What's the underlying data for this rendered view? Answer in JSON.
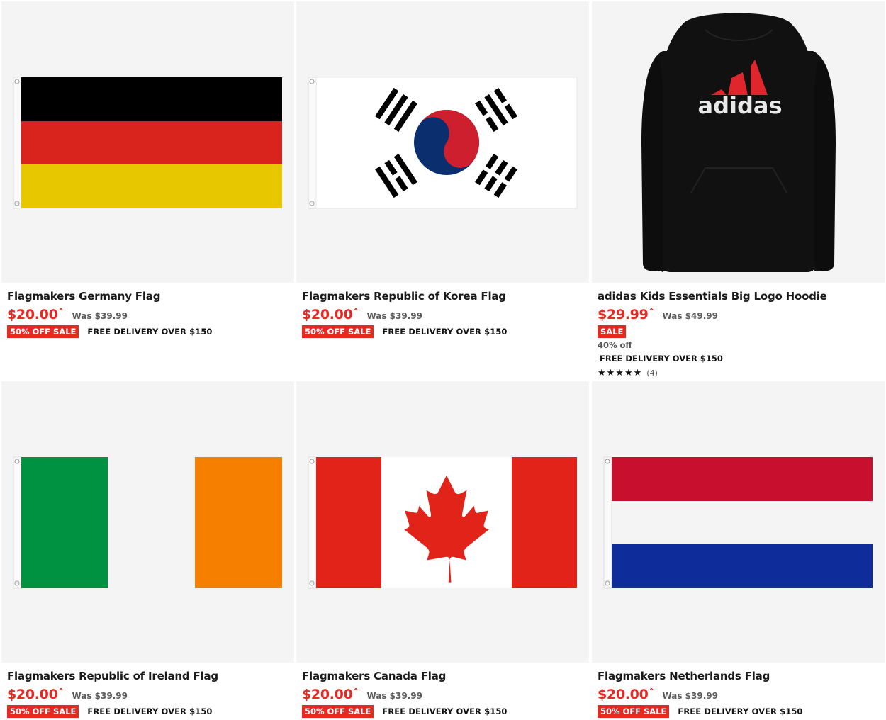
{
  "products": [
    {
      "title": "Flagmakers Germany Flag",
      "price": "$20.00",
      "price_suffix": "^",
      "was": "Was $39.99",
      "badge": "50% OFF SALE",
      "delivery": "FREE DELIVERY OVER $150"
    },
    {
      "title": "Flagmakers Republic of Korea Flag",
      "price": "$20.00",
      "price_suffix": "^",
      "was": "Was $39.99",
      "badge": "50% OFF SALE",
      "delivery": "FREE DELIVERY OVER $150"
    },
    {
      "title": "adidas Kids Essentials Big Logo Hoodie",
      "price": "$29.99",
      "price_suffix": "^",
      "was": "Was $49.99",
      "badge": "SALE",
      "off": "40% off",
      "delivery": "FREE DELIVERY OVER $150",
      "stars": "★★★★★",
      "rating_count": "(4)",
      "logo_text": "adidas"
    },
    {
      "title": "Flagmakers Republic of Ireland Flag",
      "price": "$20.00",
      "price_suffix": "^",
      "was": "Was $39.99",
      "badge": "50% OFF SALE",
      "delivery": "FREE DELIVERY OVER $150"
    },
    {
      "title": "Flagmakers Canada Flag",
      "price": "$20.00",
      "price_suffix": "^",
      "was": "Was $39.99",
      "badge": "50% OFF SALE",
      "delivery": "FREE DELIVERY OVER $150"
    },
    {
      "title": "Flagmakers Netherlands Flag",
      "price": "$20.00",
      "price_suffix": "^",
      "was": "Was $39.99",
      "badge": "50% OFF SALE",
      "delivery": "FREE DELIVERY OVER $150"
    }
  ],
  "colors": {
    "sale_red": "#e52a24",
    "image_bg": "#f4f4f4"
  }
}
